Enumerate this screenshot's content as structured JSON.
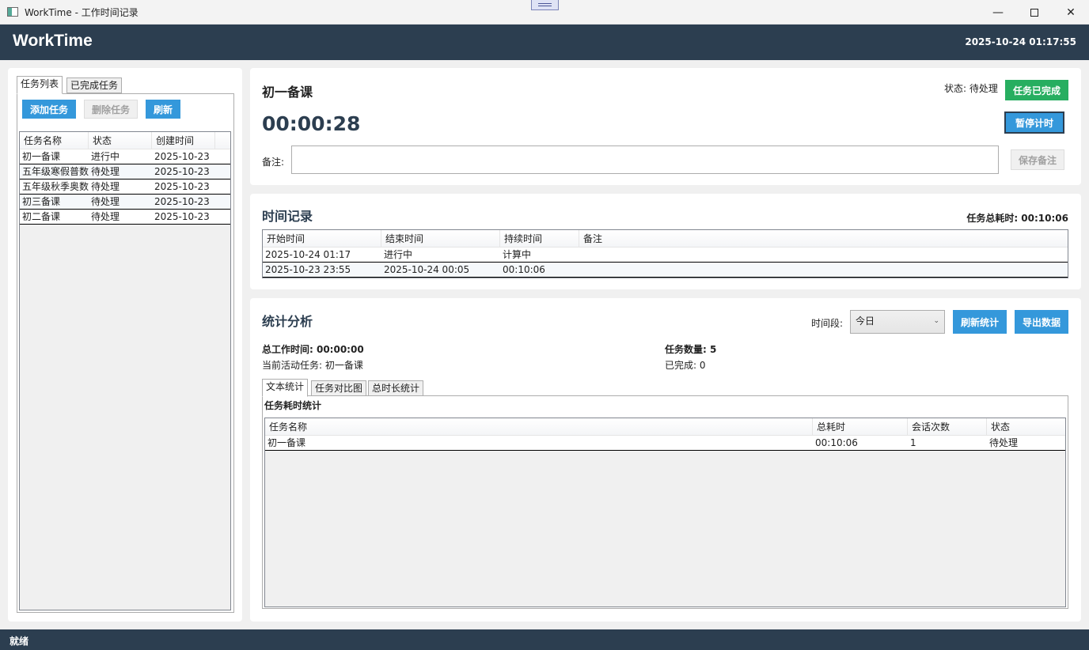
{
  "window": {
    "title": "WorkTime - 工作时间记录"
  },
  "header": {
    "brand": "WorkTime",
    "datetime": "2025-10-24 01:17:55"
  },
  "left": {
    "tabs": [
      "任务列表",
      "已完成任务"
    ],
    "buttons": {
      "add": "添加任务",
      "delete": "删除任务",
      "refresh": "刷新"
    },
    "columns": [
      "任务名称",
      "状态",
      "创建时间"
    ],
    "rows": [
      [
        "初一备课",
        "进行中",
        "2025-10-23"
      ],
      [
        "五年级寒假普数",
        "待处理",
        "2025-10-23"
      ],
      [
        "五年级秋季奥数",
        "待处理",
        "2025-10-23"
      ],
      [
        "初三备课",
        "待处理",
        "2025-10-23"
      ],
      [
        "初二备课",
        "待处理",
        "2025-10-23"
      ]
    ]
  },
  "current": {
    "task_name": "初一备课",
    "status_label": "状态: 待处理",
    "complete_button": "任务已完成",
    "timer": "00:00:28",
    "pause_button": "暂停计时",
    "note_label": "备注:",
    "note_value": "",
    "save_note_button": "保存备注"
  },
  "time_records": {
    "title": "时间记录",
    "total_label": "任务总耗时: 00:10:06",
    "columns": [
      "开始时间",
      "结束时间",
      "持续时间",
      "备注"
    ],
    "rows": [
      [
        "2025-10-24 01:17",
        "进行中",
        "计算中",
        ""
      ],
      [
        "2025-10-23 23:55",
        "2025-10-24 00:05",
        "00:10:06",
        ""
      ]
    ]
  },
  "stats": {
    "title": "统计分析",
    "period_label": "时间段:",
    "period_value": "今日",
    "refresh_button": "刷新统计",
    "export_button": "导出数据",
    "total_work_time": "总工作时间: 00:00:00",
    "task_count": "任务数量: 5",
    "active_task": "当前活动任务: 初一备课",
    "completed": "已完成: 0",
    "tabs": [
      "文本统计",
      "任务对比图",
      "总时长统计"
    ],
    "subtitle": "任务耗时统计",
    "columns": [
      "任务名称",
      "总耗时",
      "会话次数",
      "状态"
    ],
    "rows": [
      [
        "初一备课",
        "00:10:06",
        "1",
        "待处理"
      ]
    ]
  },
  "statusbar": {
    "text": "就绪"
  }
}
